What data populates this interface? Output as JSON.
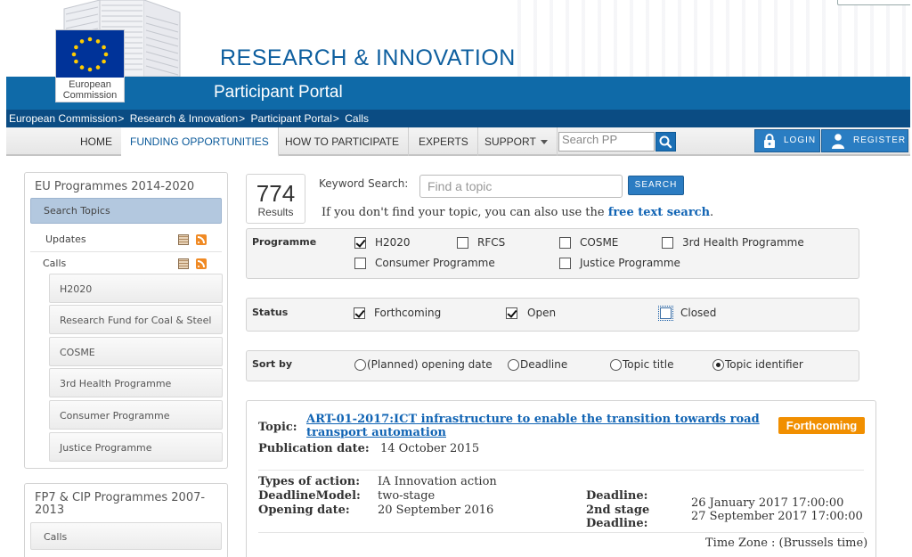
{
  "header": {
    "site_title": "RESEARCH & INNOVATION",
    "portal_title": "Participant Portal",
    "logo_text_line1": "European",
    "logo_text_line2": "Commission"
  },
  "breadcrumb": [
    "European Commission",
    "Research & Innovation",
    "Participant Portal",
    "Calls"
  ],
  "nav": {
    "items": [
      "HOME",
      "FUNDING OPPORTUNITIES",
      "HOW TO PARTICIPATE",
      "EXPERTS",
      "SUPPORT"
    ],
    "active": "FUNDING OPPORTUNITIES",
    "search_placeholder": "Search PP",
    "login_label": "LOGIN",
    "register_label": "REGISTER"
  },
  "sidebar": {
    "heading": "EU Programmes 2014-2020",
    "search_topics": "Search Topics",
    "updates": "Updates",
    "calls": "Calls",
    "programmes": [
      "H2020",
      "Research Fund for Coal & Steel",
      "COSME",
      "3rd Health Programme",
      "Consumer Programme",
      "Justice Programme"
    ],
    "heading2": "FP7 & CIP Programmes 2007-2013",
    "calls2": "Calls"
  },
  "search": {
    "count": "774",
    "count_label": "Results",
    "keyword_label": "Keyword Search:",
    "placeholder": "Find a topic",
    "button": "SEARCH",
    "hint_prefix": "If you don't find your topic, you can also use the",
    "hint_link": "free text search",
    "hint_suffix": "."
  },
  "filters": {
    "programme_label": "Programme",
    "programmes": [
      {
        "label": "H2020",
        "checked": true
      },
      {
        "label": "RFCS",
        "checked": false
      },
      {
        "label": "COSME",
        "checked": false
      },
      {
        "label": "3rd Health Programme",
        "checked": false
      },
      {
        "label": "Consumer Programme",
        "checked": false
      },
      {
        "label": "Justice Programme",
        "checked": false
      }
    ],
    "status_label": "Status",
    "status": [
      {
        "label": "Forthcoming",
        "checked": true
      },
      {
        "label": "Open",
        "checked": true
      },
      {
        "label": "Closed",
        "checked": false
      }
    ],
    "sort_label": "Sort by",
    "sort": [
      {
        "label": "(Planned) opening date",
        "selected": false
      },
      {
        "label": "Deadline",
        "selected": false
      },
      {
        "label": "Topic title",
        "selected": false
      },
      {
        "label": "Topic identifier",
        "selected": true
      }
    ]
  },
  "result": {
    "topic_label": "Topic:",
    "topic_title": "ART-01-2017:ICT infrastructure to enable the transition towards road transport automation",
    "status_badge": "Forthcoming",
    "publication_label": "Publication date:",
    "publication_date": "14 October 2015",
    "types_label": "Types of action:",
    "types_value": "IA Innovation action",
    "deadline_model_label": "DeadlineModel:",
    "deadline_model_value": "two-stage",
    "opening_label": "Opening date:",
    "opening_value": "20 September 2016",
    "deadline_label": "Deadline:",
    "second_stage_label_1": "2nd stage",
    "second_stage_label_2": "Deadline:",
    "deadline_value": "26 January 2017 17:00:00",
    "second_stage_value": "27 September 2017 17:00:00",
    "timezone": "Time Zone : (Brussels time)"
  },
  "colors": {
    "brand_blue": "#0f6aa8",
    "breadcrumb_bar": "#0b4c83",
    "link": "#1164b4",
    "badge_orange": "#f18f00",
    "eu_flag": "#003399",
    "star_yellow": "#ffcc00"
  },
  "icons": [
    "eu-flag-icon",
    "search-icon",
    "lock-icon",
    "user-icon",
    "calendar-icon",
    "rss-icon",
    "caret-down-icon"
  ]
}
